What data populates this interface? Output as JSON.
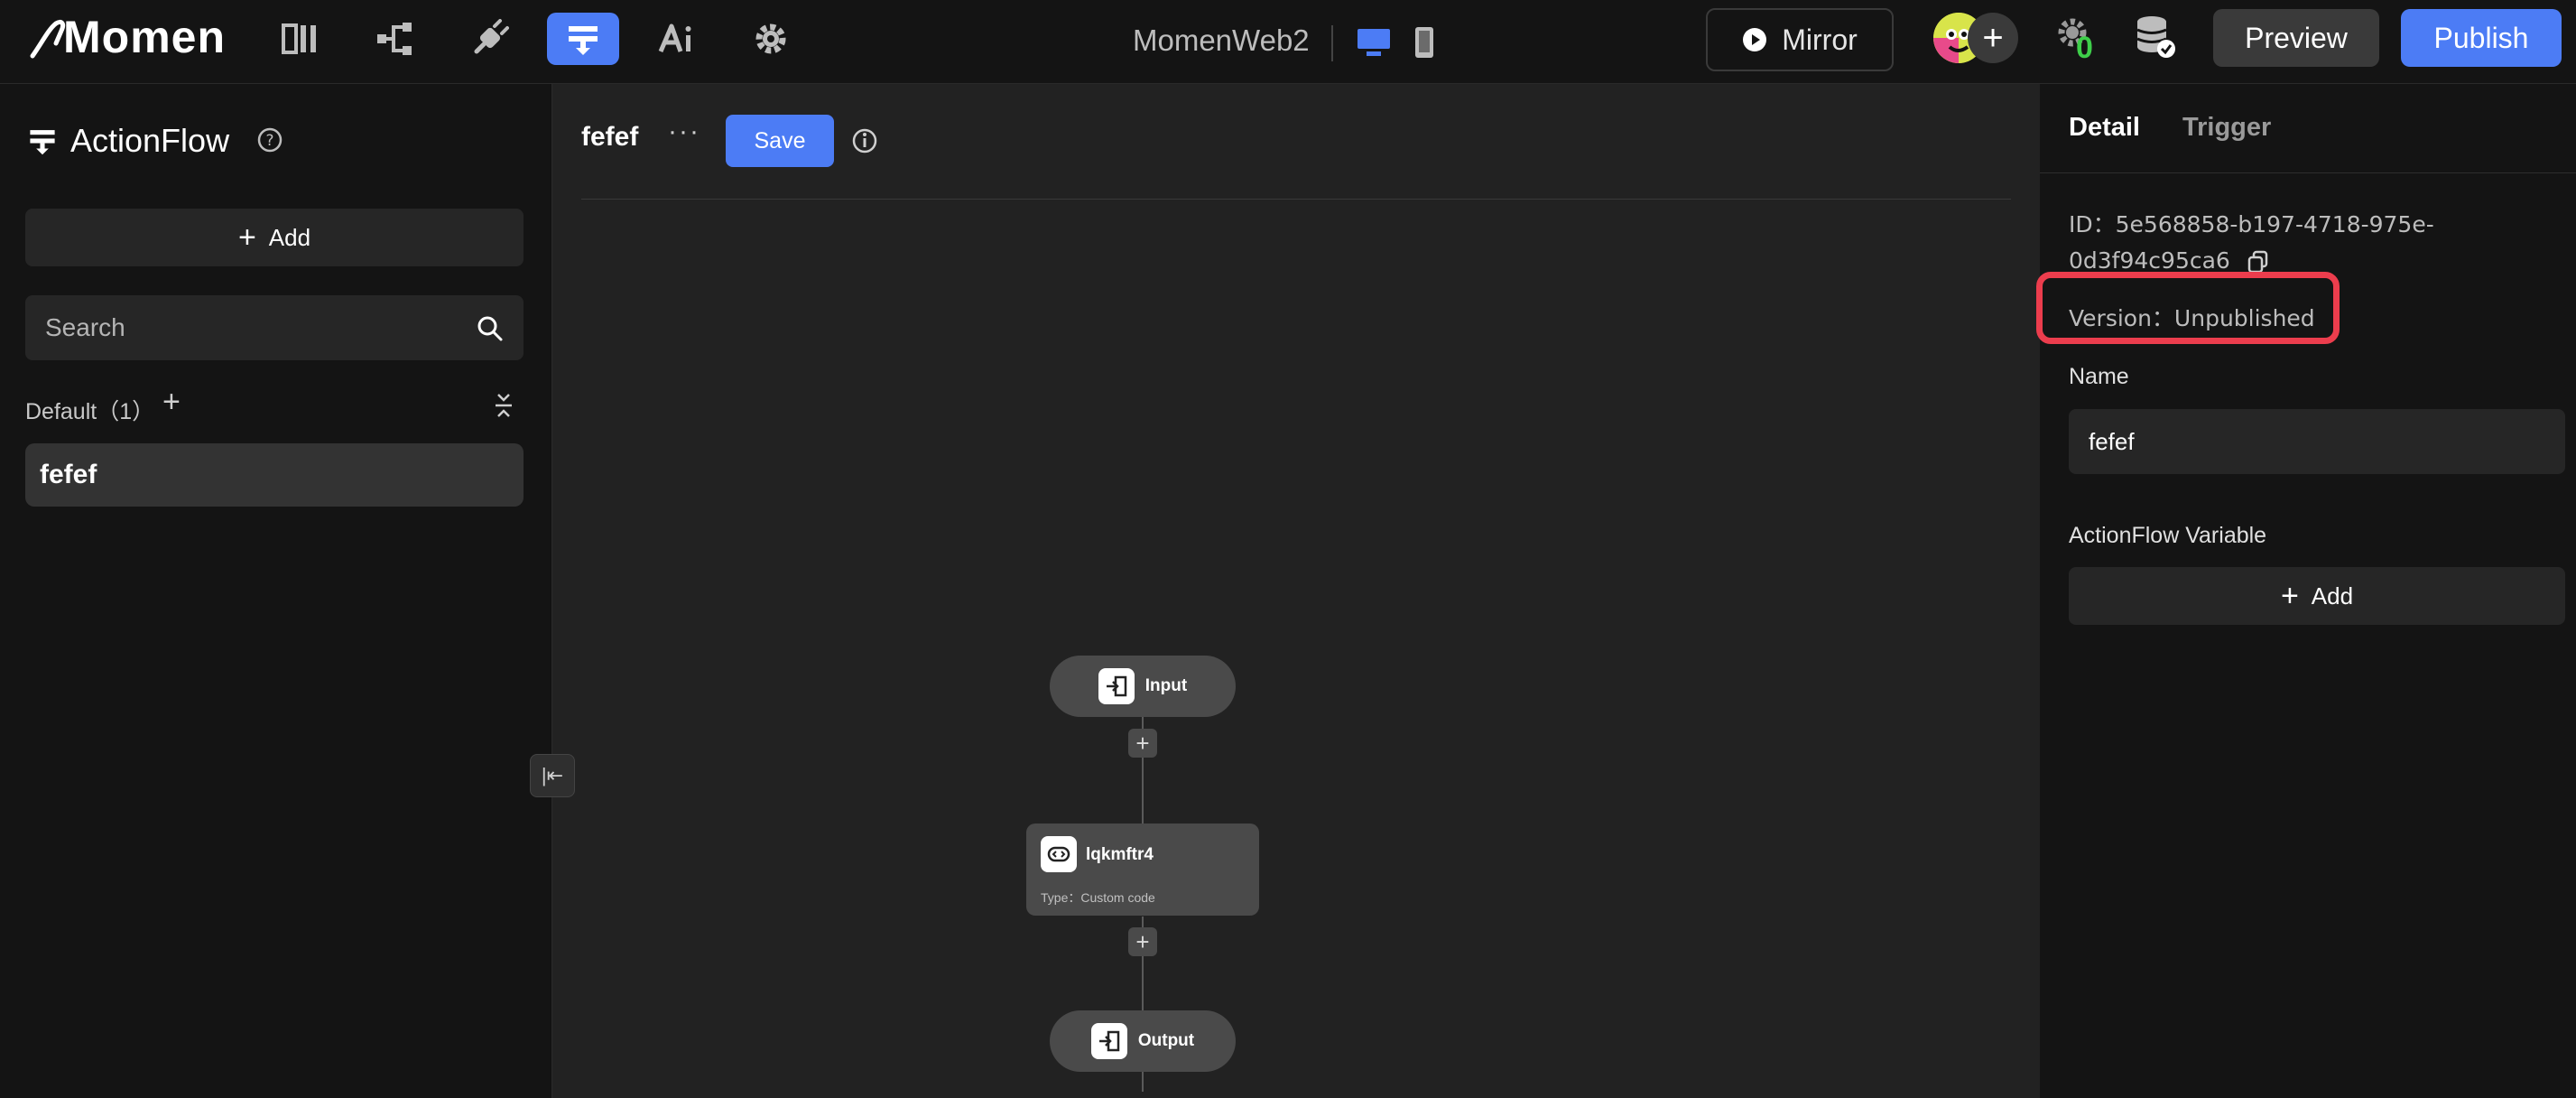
{
  "header": {
    "logo": "Momen",
    "project_name": "MomenWeb2",
    "mirror_label": "Mirror",
    "notification_count": "0",
    "preview_label": "Preview",
    "publish_label": "Publish",
    "nav_icons": [
      "layout-icon",
      "data-model-icon",
      "plugin-icon",
      "actionflow-icon",
      "ai-icon",
      "settings-icon"
    ],
    "active_nav": "actionflow-icon",
    "accent_color": "#4c7cf5"
  },
  "left_panel": {
    "title": "ActionFlow",
    "add_label": "Add",
    "search_placeholder": "Search",
    "group_label": "Default（1）",
    "items": [
      {
        "label": "fefef"
      }
    ]
  },
  "canvas": {
    "flow_name": "fefef",
    "more_label": "···",
    "save_label": "Save",
    "nodes": {
      "input": {
        "label": "Input"
      },
      "custom": {
        "label": "lqkmftr4",
        "type_text": "Type：Custom code"
      },
      "output": {
        "label": "Output"
      }
    }
  },
  "right_panel": {
    "tabs": [
      "Detail",
      "Trigger"
    ],
    "active_tab": "Detail",
    "id_text": "ID：5e568858-b197-4718-975e-0d3f94c95ca6",
    "version_text": "Version：Unpublished",
    "highlight_color": "#ec3d4d",
    "name_label": "Name",
    "name_value": "fefef",
    "variable_label": "ActionFlow Variable",
    "add_label": "Add"
  }
}
